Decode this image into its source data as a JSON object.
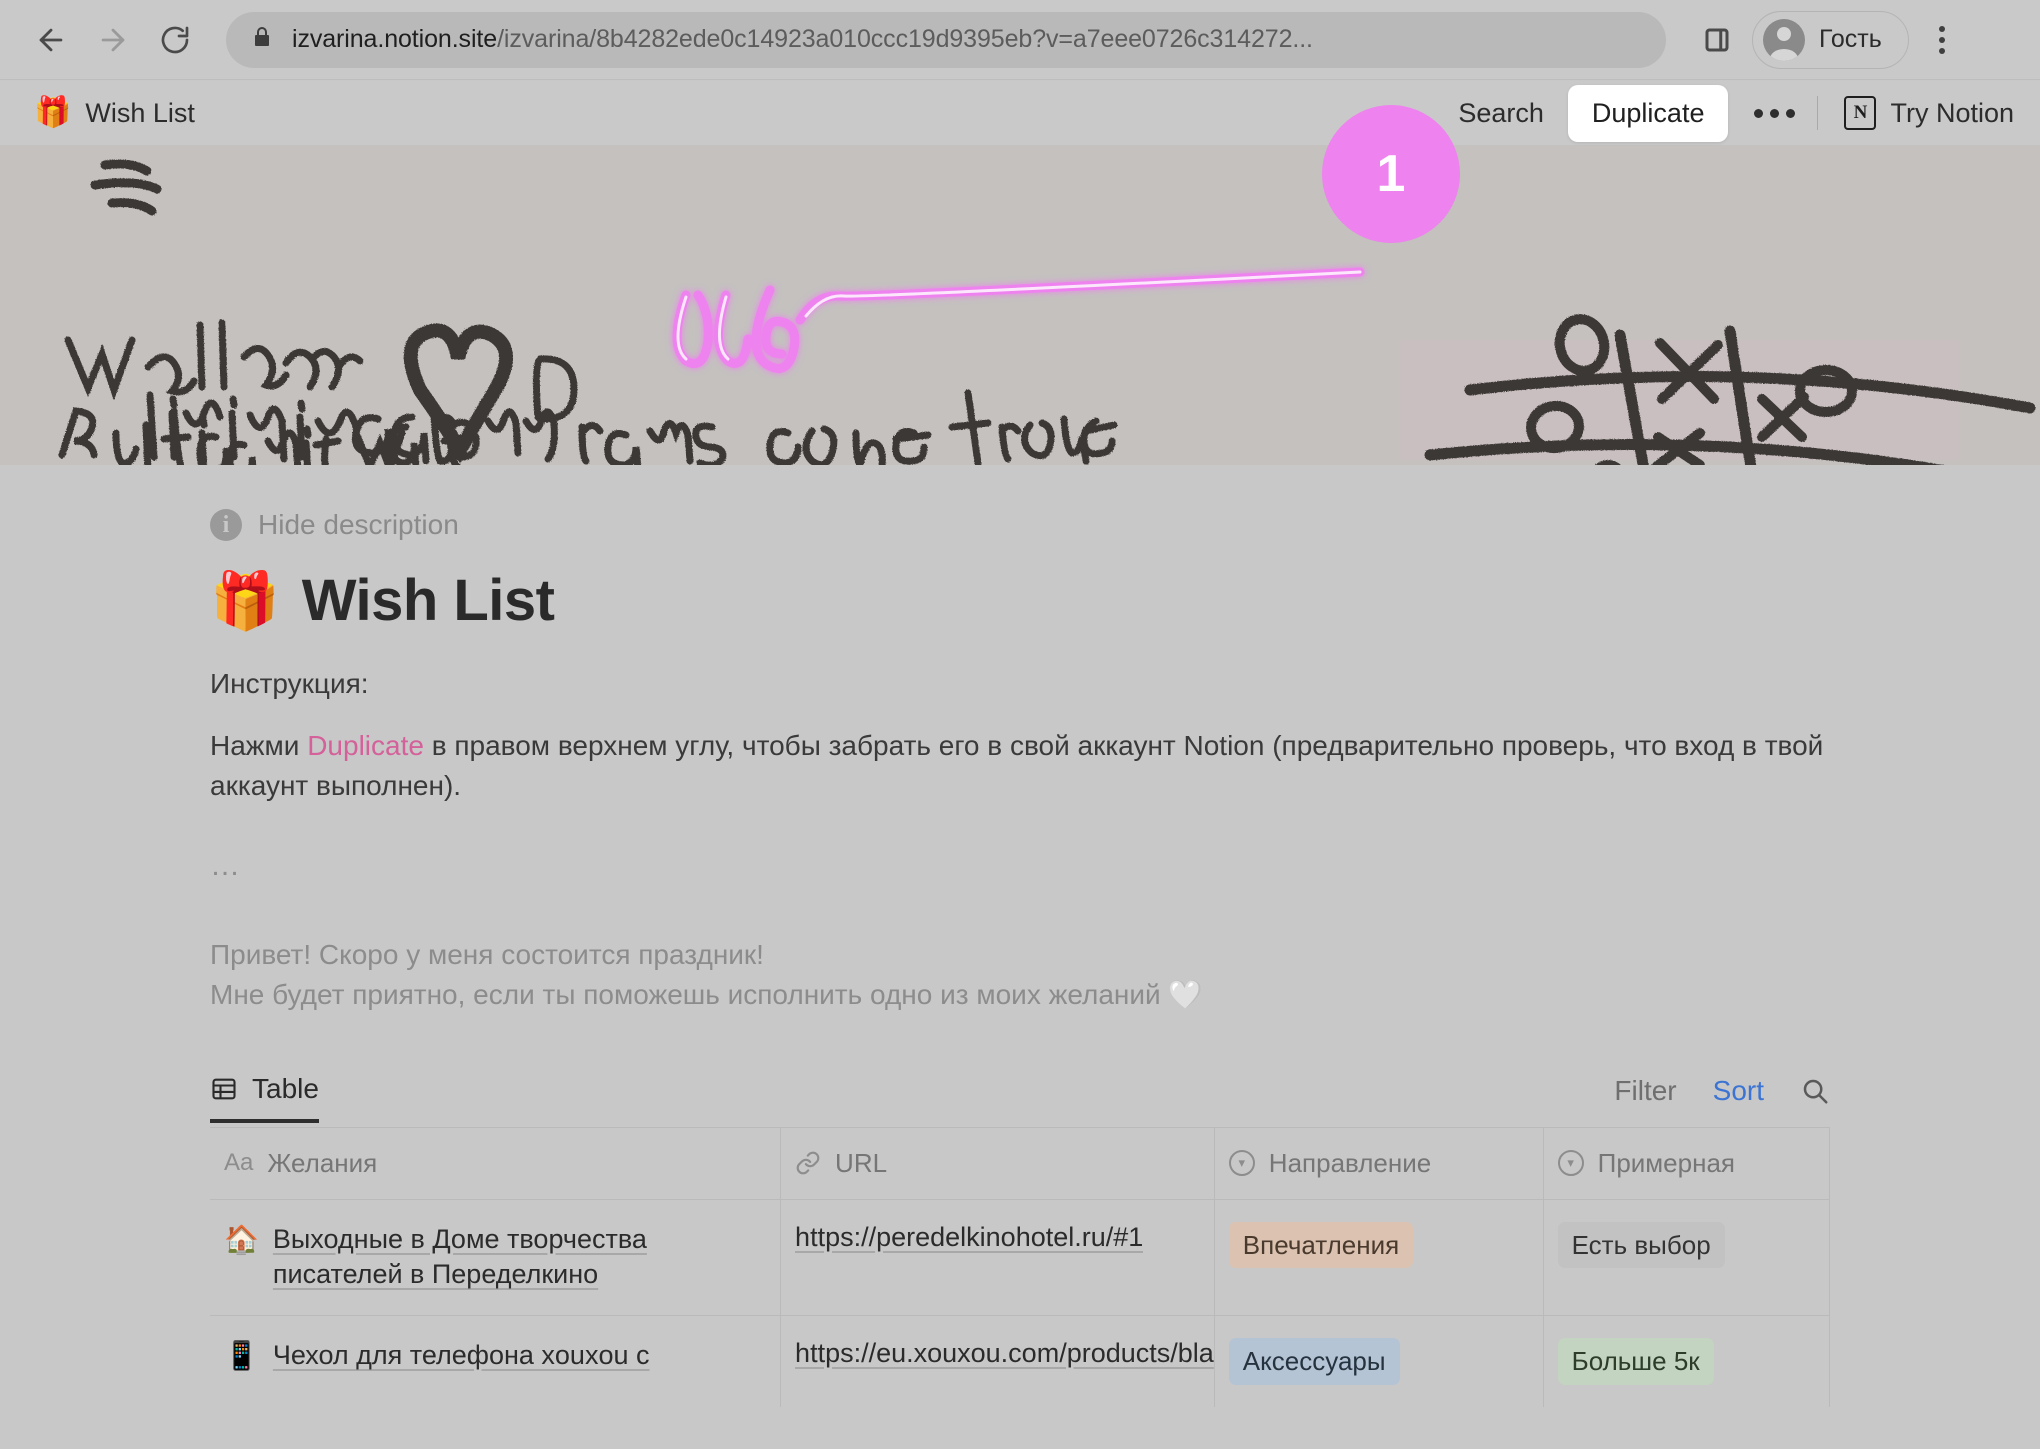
{
  "browser": {
    "back_icon": "back-arrow-icon",
    "forward_icon": "forward-arrow-icon",
    "reload_icon": "reload-icon",
    "lock_icon": "lock-icon",
    "url_host": "izvarina.notion.site",
    "url_path": "/izvarina/8b4282ede0c14923a010ccc19d9395eb?v=a7eee0726c314272...",
    "side_panel_icon": "side-panel-icon",
    "profile_name": "Гость",
    "menu_icon": "kebab-menu-icon"
  },
  "notion_nav": {
    "breadcrumb_emoji": "🎁",
    "breadcrumb_label": "Wish List",
    "search_label": "Search",
    "duplicate_label": "Duplicate",
    "more_icon": "ellipsis-icon",
    "notion_logo": "N",
    "try_notion_label": "Try Notion"
  },
  "annotation": {
    "badge_number": "1",
    "badge_color": "#ee82ee"
  },
  "cover": {
    "handwriting_line1": "We all are",
    "handwriting_line2": "living in a dream",
    "handwriting_line3": "But life ain't what",
    "handwriting_line4": "it seems",
    "handwriting_center": "Dreams come true",
    "heart_doodle": "heart-doodle",
    "tictactoe_doodle": "tic-tac-toe-doodle"
  },
  "page": {
    "hide_description_label": "Hide description",
    "info_icon": "info-icon",
    "title_emoji": "🎁",
    "title": "Wish List",
    "instruction_heading": "Инструкция:",
    "instruction_before": "Нажми ",
    "instruction_accent": "Duplicate",
    "instruction_after": " в правом верхнем углу, чтобы забрать его в свой аккаунт Notion (предварительно проверь, что вход в твой аккаунт выполнен).",
    "divider_dots": "…",
    "greeting_line1": "Привет! Скоро у меня состоится праздник!",
    "greeting_line2": "Мне будет приятно, если ты поможешь исполнить одно из моих желаний ",
    "greeting_heart": "🤍"
  },
  "database": {
    "view_tab_label": "Table",
    "view_tab_icon": "table-icon",
    "filter_label": "Filter",
    "sort_label": "Sort",
    "search_icon": "search-icon",
    "columns": [
      {
        "type_icon": "Aa",
        "label": "Желания"
      },
      {
        "type_icon": "link-icon",
        "label": "URL"
      },
      {
        "type_icon": "select-icon",
        "label": "Направление"
      },
      {
        "type_icon": "select-icon",
        "label": "Примерная"
      }
    ],
    "rows": [
      {
        "emoji": "🏠",
        "title": "Выходные в Доме творчества писателей в Переделкино",
        "url": "https://peredelkinohotel.ru/#1",
        "direction": "Впечатления",
        "direction_color": "#dcc2b0",
        "direction_text_color": "#4a3a2e",
        "price": "Есть выбор",
        "price_color": "#c2c2c2",
        "price_text_color": "#333333"
      },
      {
        "emoji": "📱",
        "title": "Чехол для телефона xouxou с",
        "url": "https://eu.xouxou.com/products/bla",
        "direction": "Аксессуары",
        "direction_color": "#b4c4d4",
        "direction_text_color": "#26333f",
        "price": "Больше 5к",
        "price_color": "#c3d4c0",
        "price_text_color": "#2d3d2a"
      }
    ]
  }
}
